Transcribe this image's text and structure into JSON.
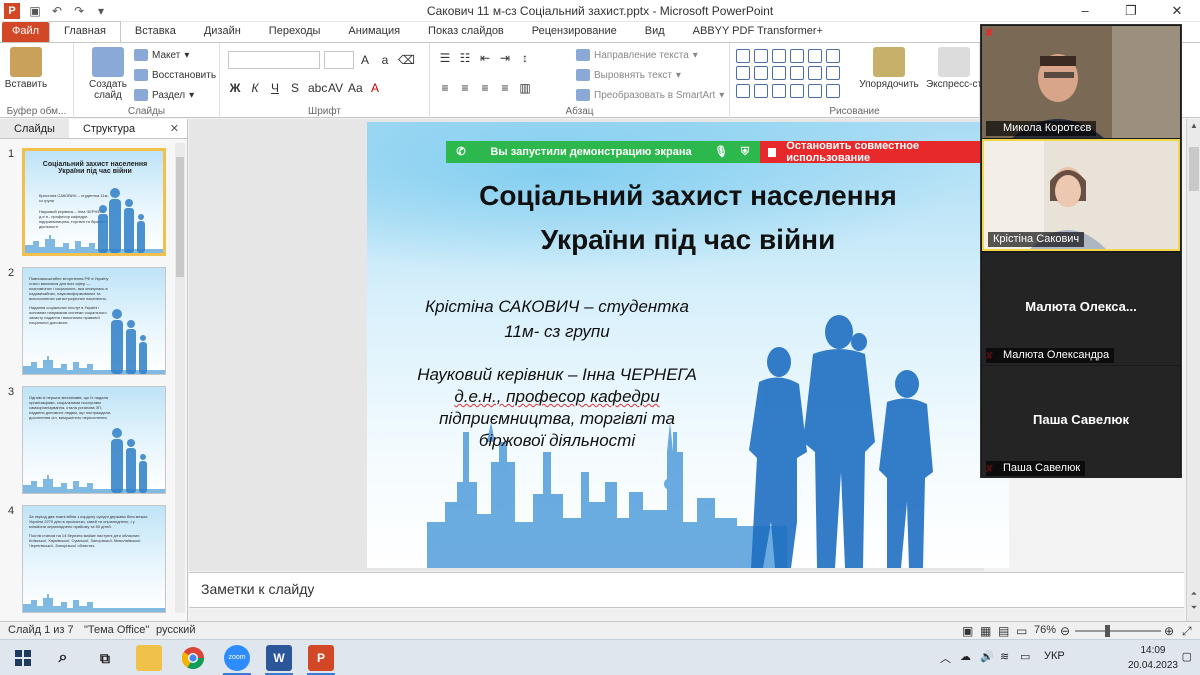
{
  "window": {
    "title": "Сакович 11 м-сз Соціальний захист.pptx - Microsoft PowerPoint"
  },
  "ribbon": {
    "tabs": [
      "Файл",
      "Главная",
      "Вставка",
      "Дизайн",
      "Переходы",
      "Анимация",
      "Показ слайдов",
      "Рецензирование",
      "Вид",
      "ABBYY PDF Transformer+"
    ],
    "active_tab": "Главная",
    "groups": {
      "clipboard": {
        "label": "Буфер обм...",
        "paste": "Вставить"
      },
      "slides": {
        "label": "Слайды",
        "new_slide": "Создать слайд",
        "layout": "Макет",
        "reset": "Восстановить",
        "section": "Раздел"
      },
      "font": {
        "label": "Шрифт"
      },
      "paragraph": {
        "label": "Абзац",
        "text_direction": "Направление текста",
        "align_text": "Выровнять текст",
        "smartart": "Преобразовать в SmartArt"
      },
      "drawing": {
        "label": "Рисование",
        "arrange": "Упорядочить",
        "quick_styles": "Экспресс-ст"
      }
    }
  },
  "slides_panel": {
    "tabs": [
      "Слайды",
      "Структура"
    ],
    "close_glyph": "✕",
    "thumbnails": [
      {
        "number": "1",
        "title": "Соціальний захист населення України під час війни",
        "lines": [
          "Кристина САКОВИЧ – студентка 11м- сз групи",
          "Науковий керівник – Інна ЧЕРНЕГА",
          "д.е.н., професор кафедри підприємництва, торгівлі та біржової діяльності"
        ]
      },
      {
        "number": "2",
        "title": "",
        "lines": [
          "Повномасштабне вторгнення РФ в Україну стало викликом для всіх сфер — економічних і соціальних, яка опинулась в надзвичайних, науковоформованих та всеохоплених катастрофічних населення.",
          "Надання соціальних послуг в Україні і основних напрямков системи соціального захисту надання і виконання правової соціальної допомоги."
        ]
      },
      {
        "number": "3",
        "title": "",
        "lines": [
          "Одним із перших механізмів, що їх надала організаціями, соціальними послугами самоорганізування, стала установа ЗП, надання допомоги людям, що постраждали, досягнення сіл, вимушеного переселення."
        ]
      },
      {
        "number": "4",
        "title": "",
        "lines": [
          "За період два тижні війни з кордону сусідні держави біля межах України 2270 діти в прихистки, сімей та оприлюднено, і у мільйони оприлюднено прийому та 50 дітей.",
          "Постів станом на 14 березня майже наступні діти обласних: Київської, Харківської, Сумської, Запорізької, Миколаївської, Чернігівської, Запорізької областях."
        ]
      }
    ]
  },
  "slide": {
    "title": "Соціальний захист населення України під час війни",
    "title_line1": "Соціальний захист населення",
    "title_line2": "України під час війни",
    "author_line1": "Крістіна САКОВИЧ – студентка",
    "author_line2": "11м- сз групи",
    "advisor_line1": "Науковий керівник – Інна ЧЕРНЕГА",
    "advisor_line2": "д.е.н., професор кафедри",
    "advisor_line3": "підприємництва, торгівлі та",
    "advisor_line4": "біржової діяльності"
  },
  "share_banner": {
    "sharing_text": "Вы запустили демонстрацию экрана",
    "stop_text": "Остановить совместное использование",
    "colors": {
      "green": "#2db84d",
      "red": "#e8292b"
    }
  },
  "notes": {
    "placeholder": "Заметки к слайду"
  },
  "status_bar": {
    "slide_info": "Слайд 1 из 7",
    "theme": "\"Тема Office\"",
    "language": "русский",
    "zoom": "76%"
  },
  "zoom_meeting": {
    "participants": [
      {
        "name": "Микола Коротєєв",
        "video": true,
        "muted": true
      },
      {
        "name": "Крістіна Сакович",
        "video": true,
        "muted": false,
        "active_speaker": true
      },
      {
        "name": "Малюта Олександра",
        "display_label": "Малюта  Олекса...",
        "video": false,
        "muted": true
      },
      {
        "name": "Паша Савелюк",
        "display_label": "Паша Савелюк",
        "video": false,
        "muted": true
      }
    ]
  },
  "taskbar": {
    "apps": [
      "start-icon",
      "search-icon",
      "task-view-icon",
      "file-explorer-icon",
      "chrome-icon",
      "zoom-icon",
      "word-icon",
      "powerpoint-icon"
    ],
    "zoom_label": "zoom",
    "word_label": "W",
    "ppt_label": "P",
    "language": "УКР",
    "time": "14:09",
    "date": "20.04.2023"
  }
}
